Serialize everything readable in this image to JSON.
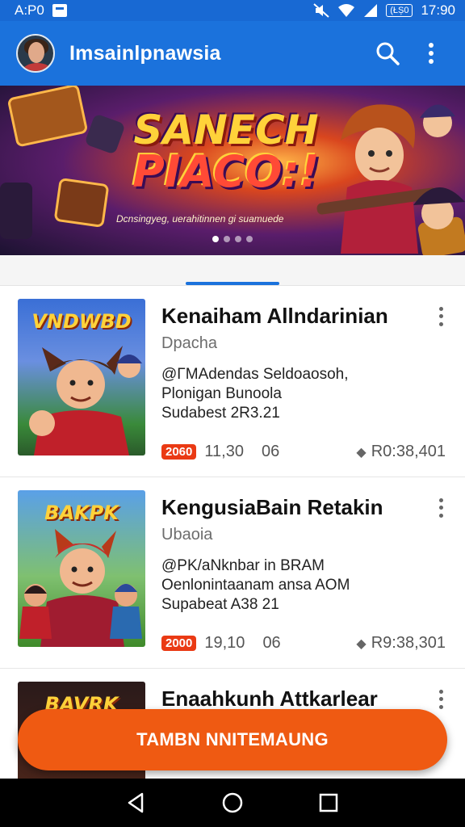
{
  "status_bar": {
    "carrier": "A:P0",
    "battery": "(ŁȘ0",
    "time": "17:90"
  },
  "app_bar": {
    "title": "Imsainlpnawsia",
    "avatar_icon": "profile-avatar",
    "search_icon": "search-icon",
    "more_icon": "more-vert-icon",
    "color": "#1b72dc"
  },
  "banner": {
    "title_line1": "SANECH",
    "title_line2": "PIACO:!",
    "caption": "Dcnsingyeg, uerahitinnen gi suamuede",
    "dot_count": 4,
    "active_dot": 0
  },
  "tabs": {
    "selected_index": 1
  },
  "items": [
    {
      "thumb_label": "VNDWBD",
      "title": "Kenaiham Allndarinian",
      "subtitle": "Dpacha",
      "desc_lines": [
        "@ΓMAdendas Seldoaosoh,",
        "Plonigan Bunoola",
        "Sudabest 2R3.21"
      ],
      "badge": "2060",
      "time": "11,30",
      "count": "06",
      "tag": "R0:38,401"
    },
    {
      "thumb_label": "BAKPK",
      "title": "KengusiaBain Retakin",
      "subtitle": "Ubaoia",
      "desc_lines": [
        "@PK/aNknbar in BRAM",
        "Oenlonintaanam ansa AOM",
        "Supabeat A38 21"
      ],
      "badge": "2000",
      "time": "19,10",
      "count": "06",
      "tag": "R9:38,301"
    },
    {
      "thumb_label": "BAVRK",
      "title": "Enaahkunh Attkarlear",
      "subtitle": "",
      "desc_lines": [],
      "badge": "",
      "time": "",
      "count": "",
      "tag": ""
    }
  ],
  "fab": {
    "label": "TAMBN NNITEMAUNG",
    "color": "#ef5a12"
  },
  "nav": {
    "back_icon": "back-triangle-icon",
    "home_icon": "home-circle-icon",
    "recents_icon": "recents-square-icon"
  }
}
